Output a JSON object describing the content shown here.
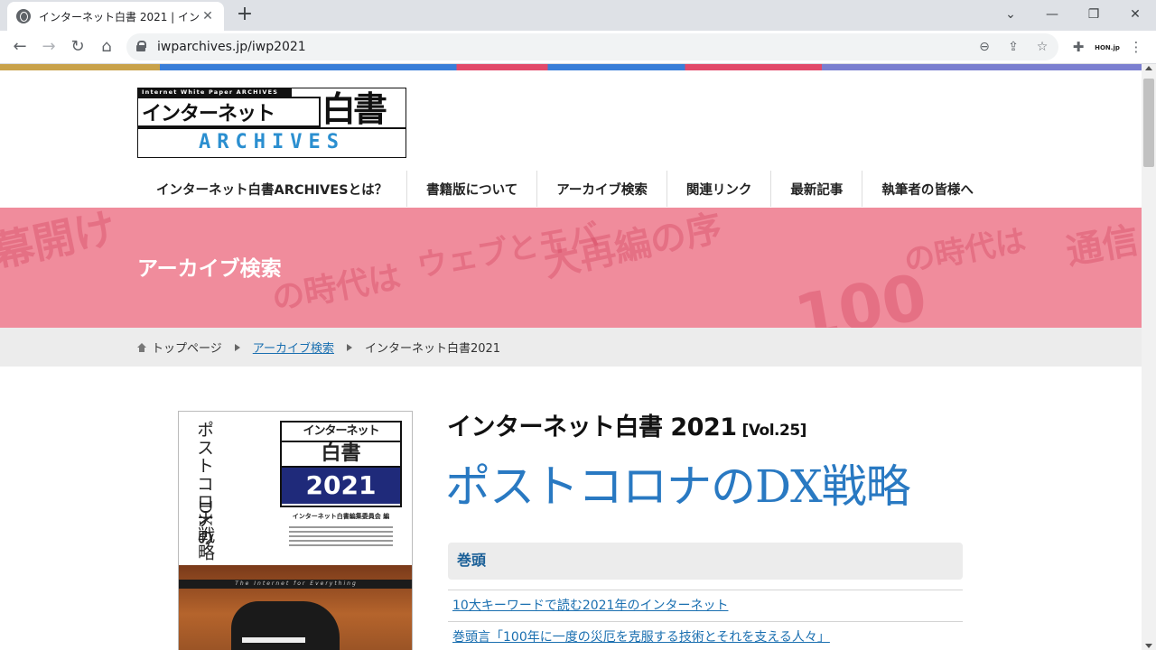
{
  "browser": {
    "tab_title": "インターネット白書 2021 | インターネッ",
    "tab_close": "✕",
    "new_tab": "+",
    "url": "iwparchives.jp/iwp2021",
    "window_controls": {
      "minimize": "—",
      "restore": "❐",
      "close": "✕"
    },
    "nav": {
      "back": "←",
      "forward": "→",
      "reload": "↻",
      "home": "⌂"
    },
    "omnibox_icons": {
      "zoom": "⊖",
      "share": "⇪",
      "bookmark": "☆"
    },
    "extensions": {
      "puzzle": "✚",
      "hon": "HON.jp"
    }
  },
  "site": {
    "logo": {
      "small": "Internet White Paper ARCHIVES",
      "main": "インターネット",
      "big": "白書",
      "archives": "ARCHIVES"
    },
    "nav": [
      "インターネット白書ARCHIVESとは？",
      "書籍版について",
      "アーカイブ検索",
      "関連リンク",
      "最新記事",
      "執筆者の皆様へ"
    ],
    "banner_title": "アーカイブ検索",
    "breadcrumb": {
      "home": "トップページ",
      "archive": "アーカイブ検索",
      "current": "インターネット白書2021"
    }
  },
  "book": {
    "cover_vertical_1": "ポストコロナの",
    "cover_vertical_2": "DX戦略",
    "cover_block_1": "インターネット",
    "cover_block_2": "白書",
    "cover_block_3": "2021",
    "cover_sub": "インターネット白書編集委員会 編",
    "cover_tagline": "The Internet for Everything",
    "title": "インターネット白書 2021",
    "volume": "[Vol.25]",
    "theme": "ポストコロナのDX戦略",
    "section_heading": "巻頭",
    "toc": [
      "10大キーワードで読む2021年のインターネット",
      "巻頭言「100年に一度の災厄を克服する技術とそれを支える人々」"
    ]
  },
  "colors": {
    "banner": "#f08c9c",
    "theme_blue": "#2979c2",
    "link": "#1a6fb0",
    "cover_blue": "#1f2a7a"
  }
}
